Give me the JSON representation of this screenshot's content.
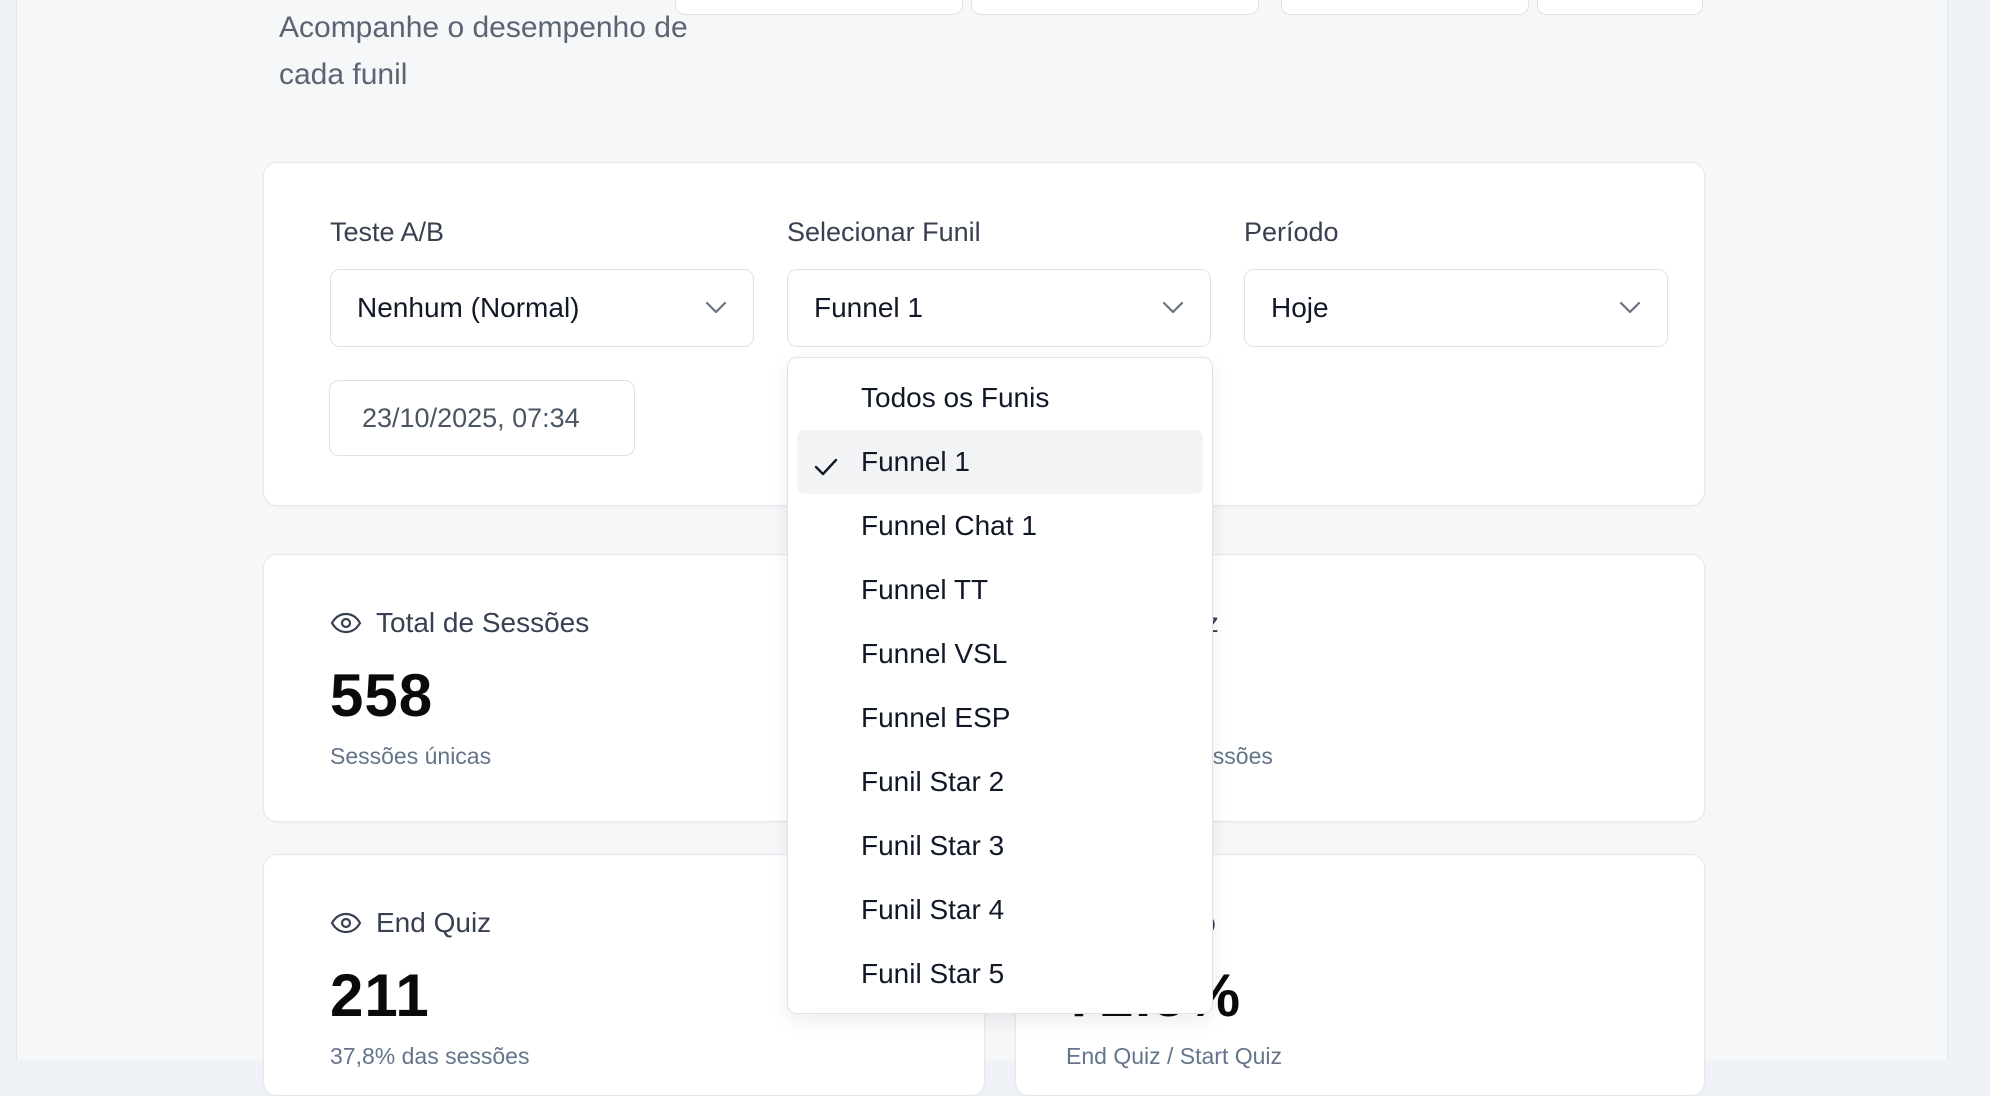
{
  "header": {
    "subtitle": "Acompanhe o desempenho de cada funil"
  },
  "filters": {
    "ab_test": {
      "label": "Teste A/B",
      "value": "Nenhum (Normal)"
    },
    "funnel": {
      "label": "Selecionar Funil",
      "value": "Funnel 1"
    },
    "period": {
      "label": "Período",
      "value": "Hoje"
    },
    "datetime": "23/10/2025, 07:34"
  },
  "funnel_dropdown": {
    "options": [
      "Todos os Funis",
      "Funnel 1",
      "Funnel Chat 1",
      "Funnel TT",
      "Funnel VSL",
      "Funnel ESP",
      "Funil Star 2",
      "Funil Star 3",
      "Funil Star 4",
      "Funil Star 5"
    ],
    "selected": "Funnel 1"
  },
  "stats": {
    "total_sessions": {
      "title": "Total de Sessões",
      "value": "558",
      "sub": "Sessões únicas"
    },
    "start_quiz": {
      "title_fragment": "uiz",
      "sub_fragment": "essões"
    },
    "end_quiz": {
      "title": "End Quiz",
      "value": "211",
      "sub": "37,8% das sessões"
    },
    "conversion": {
      "title_fragment": "io",
      "value_fragment": "72.5%",
      "sub": "End Quiz / Start Quiz"
    }
  },
  "colors": {
    "page_bg": "#f6f7f9",
    "card_bg": "#ffffff",
    "muted_text": "#64748b",
    "selected_option_bg": "#f2f3f5"
  }
}
